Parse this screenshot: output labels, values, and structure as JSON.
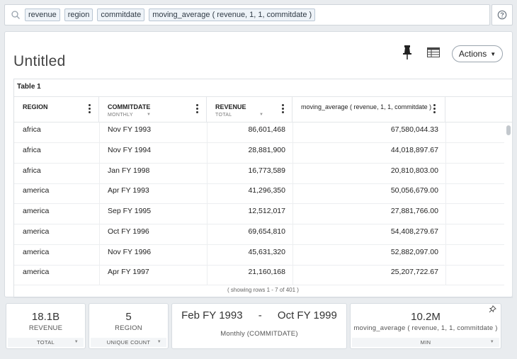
{
  "search": {
    "tokens": [
      "revenue",
      "region",
      "commitdate",
      "moving_average ( revenue, 1, 1, commitdate )"
    ]
  },
  "icons": {
    "search": "magnifier-icon",
    "help": "question-circle-icon",
    "pin": "pushpin-icon",
    "table": "table-view-icon",
    "actions_caret": "caret-down-icon",
    "kpi_pin": "pushpin-icon"
  },
  "header": {
    "title": "Untitled",
    "actions_label": "Actions"
  },
  "table": {
    "label": "Table 1",
    "columns": [
      {
        "name": "REGION",
        "sub": ""
      },
      {
        "name": "COMMITDATE",
        "sub": "MONTHLY"
      },
      {
        "name": "REVENUE",
        "sub": "TOTAL"
      },
      {
        "name": "moving_average ( revenue, 1, 1, commitdate )",
        "sub": ""
      }
    ],
    "rows": [
      [
        "africa",
        "Nov FY 1993",
        "86,601,468",
        "67,580,044.33"
      ],
      [
        "africa",
        "Nov FY 1994",
        "28,881,900",
        "44,018,897.67"
      ],
      [
        "africa",
        "Jan FY 1998",
        "16,773,589",
        "20,810,803.00"
      ],
      [
        "america",
        "Apr FY 1993",
        "41,296,350",
        "50,056,679.00"
      ],
      [
        "america",
        "Sep FY 1995",
        "12,512,017",
        "27,881,766.00"
      ],
      [
        "america",
        "Oct FY 1996",
        "69,654,810",
        "54,408,279.67"
      ],
      [
        "america",
        "Nov FY 1996",
        "45,631,320",
        "52,882,097.00"
      ],
      [
        "america",
        "Apr FY 1997",
        "21,160,168",
        "25,207,722.67"
      ]
    ],
    "rows_info": "( showing rows 1 - 7 of 401 )"
  },
  "kpis": {
    "revenue": {
      "value": "18.1B",
      "label": "REVENUE",
      "footer": "TOTAL"
    },
    "region": {
      "value": "5",
      "label": "REGION",
      "footer": "UNIQUE COUNT"
    },
    "range": {
      "start": "Feb FY 1993",
      "separator": "-",
      "end": "Oct FY 1999",
      "label": "Monthly (COMMITDATE)"
    },
    "moving": {
      "value": "10.2M",
      "label": "moving_average ( revenue, 1, 1, commitdate )",
      "footer": "MIN"
    }
  },
  "colors": {
    "background": "#e9ecef",
    "token_bg": "#eef3f8",
    "token_border": "#b9c6d3"
  }
}
